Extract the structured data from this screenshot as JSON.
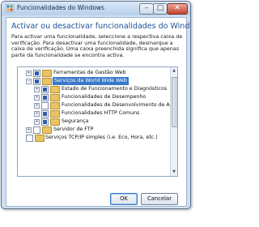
{
  "window": {
    "title": "Funcionalidades do Windows",
    "minimize_glyph": "–",
    "maximize_glyph": "□",
    "close_glyph": "✕"
  },
  "heading": "Activar ou desactivar funcionalidades do Windows",
  "description": "Para activar uma funcionalidade, seleccione a respectiva caixa de verificação. Para desactivar uma funcionalidade, desmarque a caixa de verificação. Uma caixa preenchida significa que apenas parte da funcionalidade se encontra activa.",
  "tree": {
    "items": [
      {
        "label": "Ferramentas de Gestão Web",
        "expander": "+",
        "state": "partial"
      },
      {
        "label": "Serviços da World Wide Web",
        "expander": "−",
        "state": "partial",
        "selected": true
      },
      {
        "label": "Estado de Funcionamento e Diagnósticos",
        "expander": "+",
        "state": "partial"
      },
      {
        "label": "Funcionalidades de Desempenho",
        "expander": "+",
        "state": "partial"
      },
      {
        "label": "Funcionalidades de Desenvolvimento de Aplicações",
        "expander": "+",
        "state": "unchecked"
      },
      {
        "label": "Funcionalidades HTTP Comuns",
        "expander": "+",
        "state": "partial"
      },
      {
        "label": "Segurança",
        "expander": "+",
        "state": "partial"
      },
      {
        "label": "Servidor de FTP",
        "expander": "+",
        "state": "unchecked"
      },
      {
        "label": "Serviços TCP/IP simples (i.e. Eco, Hora, etc.)",
        "expander": "",
        "state": "unchecked"
      }
    ],
    "scroll_up": "▲",
    "scroll_down": "▼"
  },
  "buttons": {
    "ok": "OK",
    "cancel": "Cancelar"
  },
  "colors": {
    "heading": "#1e4f96",
    "selection": "#3a78c8",
    "folder": "#e9c464"
  }
}
